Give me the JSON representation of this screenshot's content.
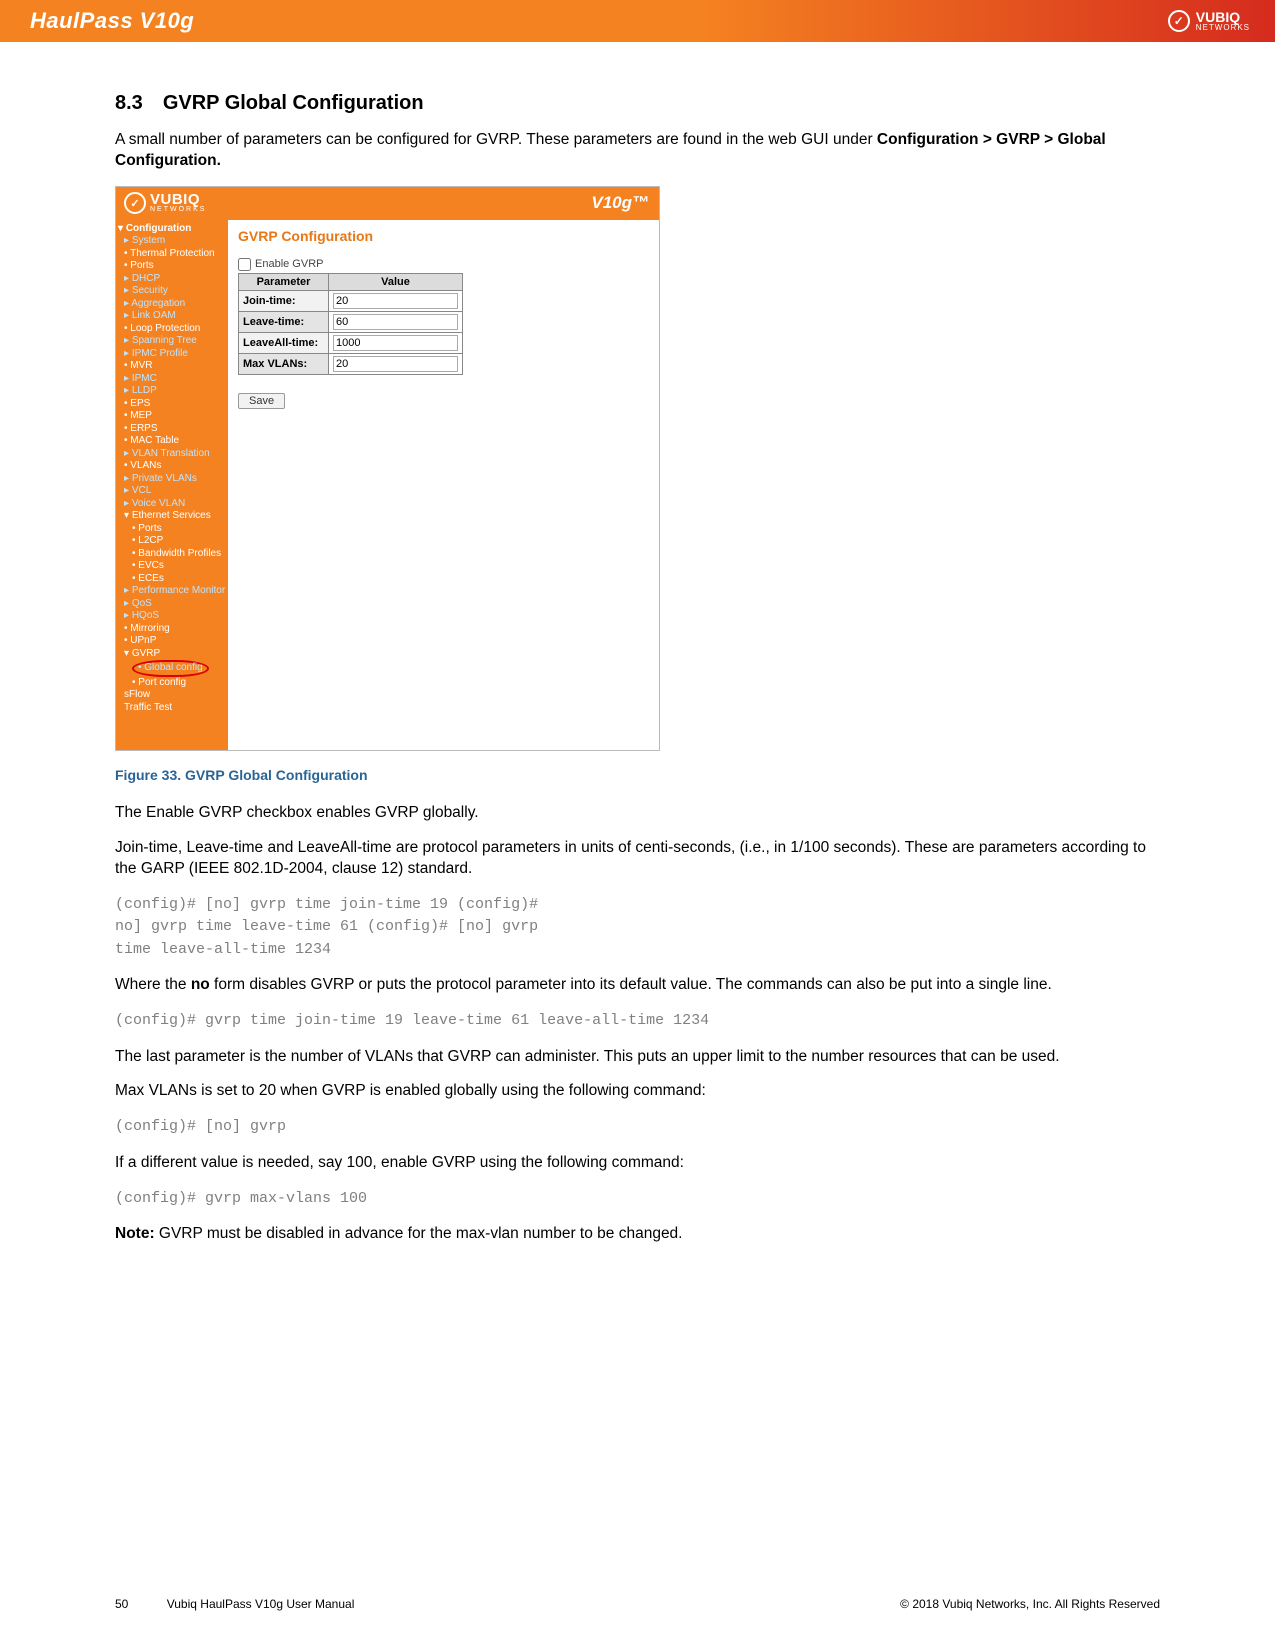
{
  "banner": {
    "product": "HaulPass V10g",
    "brand_top": "VUBIQ",
    "brand_sub": "NETWORKS"
  },
  "section": {
    "number": "8.3",
    "title": "GVRP Global Configuration"
  },
  "intro_prefix": "A small number of parameters can be configured for GVRP. These parameters are found in the web GUI under ",
  "intro_bold": "Configuration > GVRP > Global Configuration.",
  "screenshot": {
    "brand_top": "VUBIQ",
    "brand_sub": "NETWORKS",
    "product": "V10g™",
    "sidebar": {
      "root": "Configuration",
      "items": [
        "System",
        "Thermal Protection",
        "Ports",
        "DHCP",
        "Security",
        "Aggregation",
        "Link OAM",
        "Loop Protection",
        "Spanning Tree",
        "IPMC Profile",
        "MVR",
        "IPMC",
        "LLDP",
        "EPS",
        "MEP",
        "ERPS",
        "MAC Table",
        "VLAN Translation",
        "VLANs",
        "Private VLANs",
        "VCL",
        "Voice VLAN",
        "Ethernet Services"
      ],
      "eth_sub": [
        "Ports",
        "L2CP",
        "Bandwidth Profiles",
        "EVCs",
        "ECEs"
      ],
      "items2": [
        "Performance Monitor",
        "QoS",
        "HQoS",
        "Mirroring",
        "UPnP",
        "GVRP"
      ],
      "gvrp_sub": [
        "Global config",
        "Port config"
      ],
      "items3": [
        "sFlow",
        "Traffic Test"
      ]
    },
    "panel": {
      "title": "GVRP Configuration",
      "checkbox_label": "Enable GVRP",
      "header_param": "Parameter",
      "header_value": "Value",
      "rows": [
        {
          "label": "Join-time:",
          "value": "20"
        },
        {
          "label": "Leave-time:",
          "value": "60"
        },
        {
          "label": "LeaveAll-time:",
          "value": "1000"
        },
        {
          "label": "Max VLANs:",
          "value": "20"
        }
      ],
      "save": "Save"
    }
  },
  "caption": "Figure 33. GVRP Global Configuration",
  "para1": "The Enable GVRP checkbox enables GVRP globally.",
  "para2": "Join-time, Leave-time and LeaveAll-time are protocol parameters in units of centi-seconds, (i.e., in 1/100 seconds). These are parameters according to the GARP (IEEE 802.1D-2004, clause 12) standard.",
  "cmd1": "(config)# [no] gvrp time join-time 19 (config)#\nno] gvrp time leave-time 61 (config)# [no] gvrp\ntime leave-all-time 1234",
  "para3_pre": "Where the ",
  "para3_bold": "no",
  "para3_post": " form disables GVRP or puts the protocol parameter into its default value. The commands can also be put into a single line.",
  "cmd2": "(config)# gvrp time join-time 19 leave-time 61 leave-all-time 1234",
  "para4": "The last parameter is the number of VLANs that GVRP can administer. This puts an upper limit to the number resources that can be used.",
  "para5": "Max VLANs is set to 20 when GVRP is enabled globally using the following command:",
  "cmd3": "(config)# [no] gvrp",
  "para6": "If a different value is needed, say 100, enable GVRP using the following command:",
  "cmd4": "(config)# gvrp max-vlans 100",
  "note_bold": "Note:",
  "note_post": " GVRP must be disabled in advance for the max-vlan number to be changed.",
  "footer": {
    "page": "50",
    "manual": "Vubiq HaulPass V10g User Manual",
    "copyright": "© 2018 Vubiq Networks, Inc. All Rights Reserved"
  }
}
